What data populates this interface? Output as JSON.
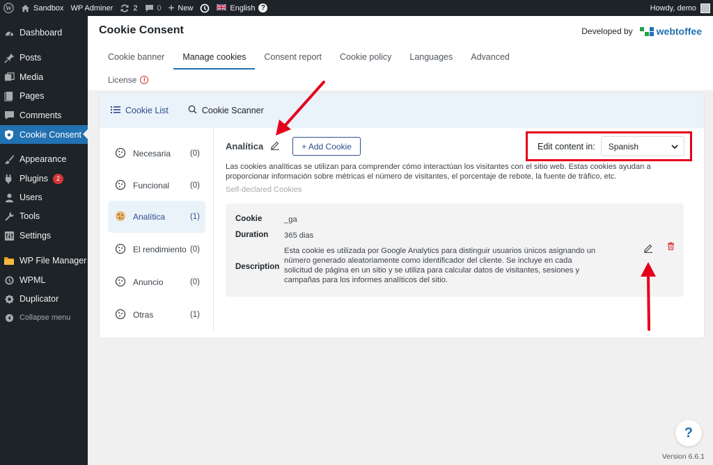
{
  "adminbar": {
    "site_name": "Sandbox",
    "adminer": "WP Adminer",
    "updates_count": "2",
    "comments_count": "0",
    "new_label": "New",
    "language": "English",
    "greeting": "Howdy, demo"
  },
  "sidebar": {
    "items": [
      {
        "label": "Dashboard",
        "icon": "dashboard-icon"
      },
      {
        "label": "Posts",
        "icon": "pin-icon"
      },
      {
        "label": "Media",
        "icon": "media-icon"
      },
      {
        "label": "Pages",
        "icon": "pages-icon"
      },
      {
        "label": "Comments",
        "icon": "comment-icon"
      },
      {
        "label": "Cookie Consent",
        "icon": "shield-icon"
      },
      {
        "label": "Appearance",
        "icon": "brush-icon"
      },
      {
        "label": "Plugins",
        "icon": "plugin-icon",
        "badge": "2"
      },
      {
        "label": "Users",
        "icon": "users-icon"
      },
      {
        "label": "Tools",
        "icon": "wrench-icon"
      },
      {
        "label": "Settings",
        "icon": "settings-icon"
      },
      {
        "label": "WP File Manager",
        "icon": "folder-icon"
      },
      {
        "label": "WPML",
        "icon": "wpml-icon"
      },
      {
        "label": "Duplicator",
        "icon": "duplicator-icon"
      },
      {
        "label": "Collapse menu",
        "icon": "collapse-icon"
      }
    ]
  },
  "header": {
    "title": "Cookie Consent",
    "developed_by": "Developed by",
    "brand": "webtoffee",
    "tabs": [
      "Cookie banner",
      "Manage cookies",
      "Consent report",
      "Cookie policy",
      "Languages",
      "Advanced"
    ],
    "license": "License"
  },
  "subnav": {
    "cookie_list": "Cookie List",
    "cookie_scanner": "Cookie Scanner"
  },
  "categories": [
    {
      "name": "Necesaria",
      "count": "(0)"
    },
    {
      "name": "Funcional",
      "count": "(0)"
    },
    {
      "name": "Analítica",
      "count": "(1)"
    },
    {
      "name": "El rendimiento",
      "count": "(0)"
    },
    {
      "name": "Anuncio",
      "count": "(0)"
    },
    {
      "name": "Otras",
      "count": "(1)"
    }
  ],
  "category_detail": {
    "name": "Analítica",
    "add_cookie": "+ Add Cookie",
    "edit_content_label": "Edit content in:",
    "language_selected": "Spanish",
    "description": "Las cookies analíticas se utilizan para comprender cómo interactúan los visitantes con el sitio web. Estas cookies ayudan a proporcionar información sobre métricas el número de visitantes, el porcentaje de rebote, la fuente de tráfico, etc.",
    "self_declared": "Self-declared Cookies"
  },
  "cookie": {
    "cookie_label": "Cookie",
    "cookie_value": "_ga",
    "duration_label": "Duration",
    "duration_value": "365 dias",
    "description_label": "Description",
    "description_value": "Esta cookie es utilizada por Google Analytics para distinguir usuarios únicos asignando un número generado aleatoriamente como identificador del cliente. Se incluye en cada solicitud de página en un sitio y se utiliza para calcular datos de visitantes, sesiones y campañas para los informes analíticos del sitio."
  },
  "footer": {
    "help": "?",
    "version": "Version 6.6.1"
  },
  "colors": {
    "wp_dark": "#1d2327",
    "wp_blue": "#2271b1",
    "accent_navy": "#2d4e8a",
    "highlight_red": "#e4001b",
    "delete_red": "#d63638"
  }
}
